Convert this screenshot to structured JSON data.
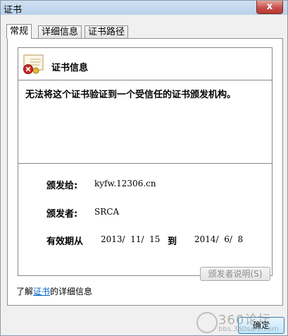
{
  "window": {
    "title": "证书",
    "close_label": "x"
  },
  "tabs": [
    {
      "label": "常规"
    },
    {
      "label": "详细信息"
    },
    {
      "label": "证书路径"
    }
  ],
  "cert": {
    "heading": "证书信息",
    "message": "无法将这个证书验证到一个受信任的证书颁发机构。",
    "issued_to_label": "颁发给:",
    "issued_to_value": "kyfw.12306.cn",
    "issued_by_label": "颁发者:",
    "issued_by_value": "SRCA",
    "validity_label": "有效期从",
    "valid_from": "2013/  11/  15",
    "to_label": "到",
    "valid_to": "2014/  6/  8"
  },
  "buttons": {
    "issuer_statement": "颁发者说明(S)",
    "ok": "确定"
  },
  "learn_more": {
    "prefix": "了解",
    "link": "证书",
    "suffix": "的详细信息"
  },
  "watermark": {
    "top": "360论坛",
    "bottom": "bbs.360safe.com"
  }
}
